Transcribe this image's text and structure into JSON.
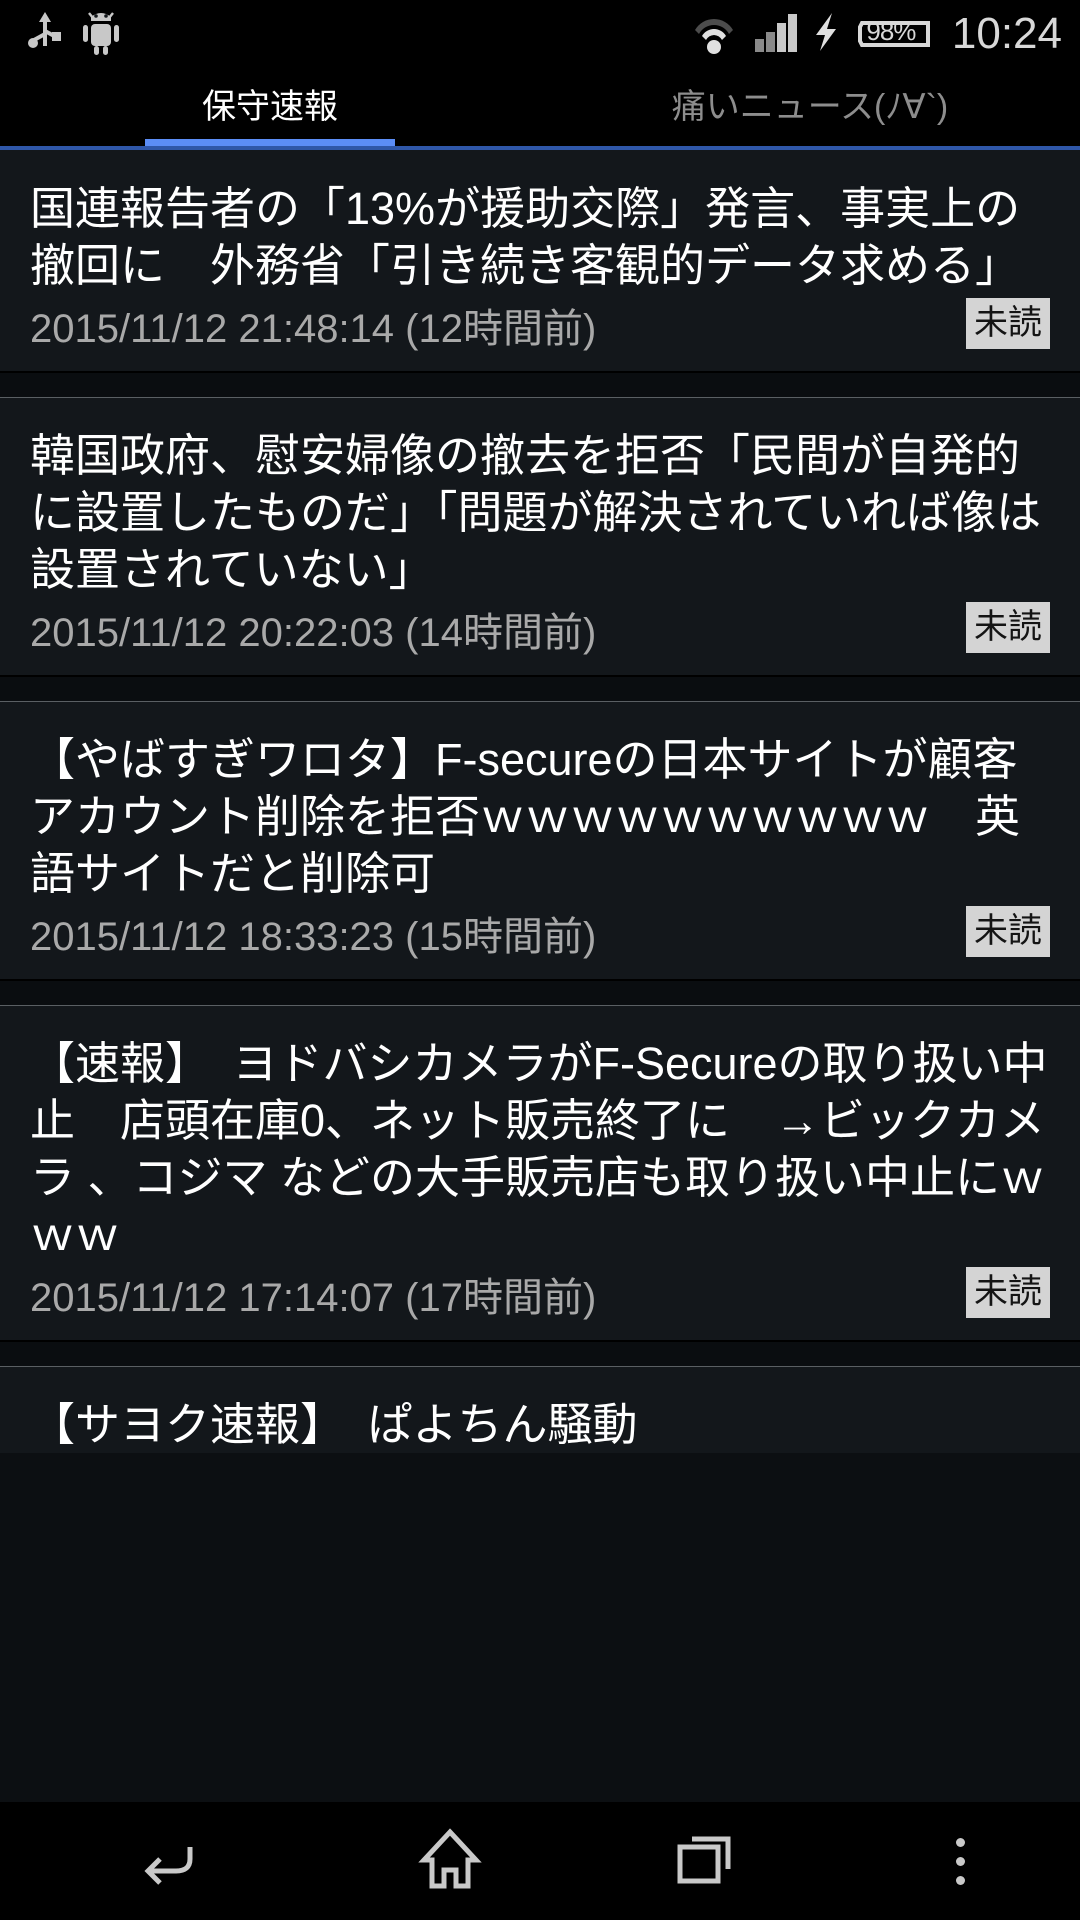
{
  "status_bar": {
    "icons": [
      "usb-icon",
      "android-debug-icon",
      "wifi-icon",
      "cellular-signal-icon",
      "charging-bolt-icon",
      "battery-icon"
    ],
    "battery_percent": "98%",
    "clock": "10:24"
  },
  "tabs": [
    {
      "label": "保守速報",
      "active": true
    },
    {
      "label": "痛いニュース(ﾉ∀`)",
      "active": false
    }
  ],
  "colors": {
    "accent": "#5b8df6",
    "divider": "#2f57a8",
    "item_bg": "#13171b",
    "badge_bg": "#d4d4d4",
    "badge_text": "#141414",
    "title_text": "#ffffff",
    "date_text": "#a9a9a9"
  },
  "articles": [
    {
      "title": "国連報告者の「13%が援助交際」発言、事実上の撤回に　外務省「引き続き客観的データ求める」",
      "date": "2015/11/12 21:48:14 (12時間前)",
      "status_badge": "未読"
    },
    {
      "title": "韓国政府、慰安婦像の撤去を拒否「民間が自発的に設置したものだ」「問題が解決されていれば像は設置されていない」",
      "date": "2015/11/12 20:22:03 (14時間前)",
      "status_badge": "未読"
    },
    {
      "title": "【やばすぎワロタ】F-secureの日本サイトが顧客アカウント削除を拒否ｗｗｗｗｗｗｗｗｗｗ　英語サイトだと削除可",
      "date": "2015/11/12 18:33:23 (15時間前)",
      "status_badge": "未読"
    },
    {
      "title": "【速報】　ヨドバシカメラがF-Secureの取り扱い中止　店頭在庫0、ネット販売終了に　→ビックカメラ 、コジマ などの大手販売店も取り扱い中止にｗｗｗ",
      "date": "2015/11/12 17:14:07 (17時間前)",
      "status_badge": "未読"
    },
    {
      "title": "【サヨク速報】　ぱよちん騒動",
      "date": "",
      "status_badge": ""
    }
  ],
  "nav_bar": {
    "buttons": [
      {
        "name": "back-icon",
        "label": "Back"
      },
      {
        "name": "home-icon",
        "label": "Home"
      },
      {
        "name": "recents-icon",
        "label": "Recents"
      },
      {
        "name": "overflow-menu-icon",
        "label": "Menu"
      }
    ]
  }
}
